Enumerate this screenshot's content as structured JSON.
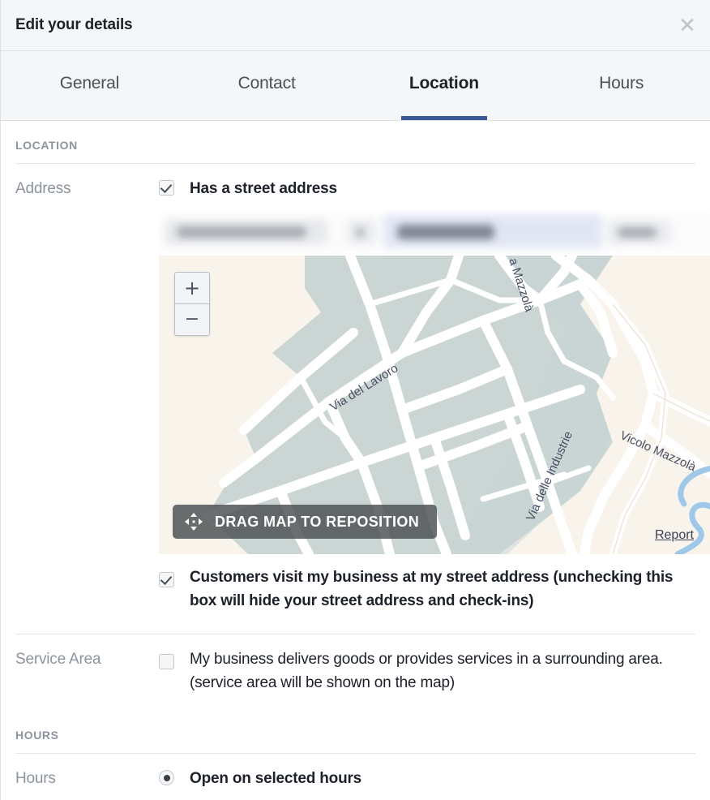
{
  "dialog": {
    "title": "Edit your details",
    "close_icon": "close-icon",
    "accent_color": "#3b5998"
  },
  "tabs": [
    {
      "label": "General",
      "active": false
    },
    {
      "label": "Contact",
      "active": false
    },
    {
      "label": "Location",
      "active": true
    },
    {
      "label": "Hours",
      "active": false
    }
  ],
  "location_section": {
    "heading": "LOCATION",
    "address_row": {
      "label": "Address",
      "has_street_address": {
        "label": "Has a street address",
        "checked": true
      },
      "address_value_redacted": true
    },
    "map": {
      "drag_badge_label": "DRAG MAP TO REPOSITION",
      "drag_icon": "move-arrows-icon",
      "zoom_in_label": "+",
      "zoom_out_label": "−",
      "report_link_label": "Report",
      "pin_color": "#a52a62",
      "streets": [
        "Via del Lavoro",
        "Via delle Industrie",
        "Via Mazzolà",
        "Vicolo Mazzolà"
      ]
    },
    "visit_checkbox": {
      "label": "Customers visit my business at my street address (unchecking this box will hide your street address and check-ins)",
      "checked": true
    },
    "service_area_row": {
      "label": "Service Area",
      "checkbox": {
        "label": "My business delivers goods or provides services in a surrounding area. (service area will be shown on the map)",
        "checked": false
      }
    }
  },
  "hours_section": {
    "heading": "HOURS",
    "row_label": "Hours",
    "option": {
      "label": "Open on selected hours",
      "selected": true
    }
  }
}
